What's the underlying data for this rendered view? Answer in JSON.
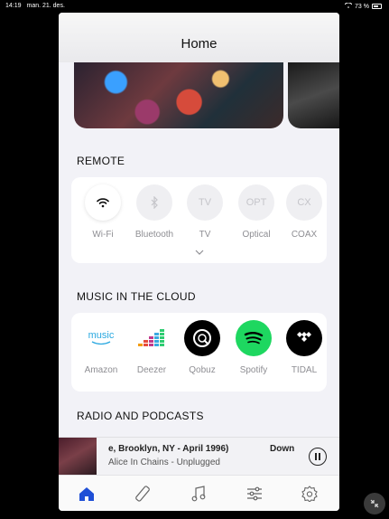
{
  "status_bar": {
    "time": "14:19",
    "date": "man. 21. des.",
    "battery": "73 %"
  },
  "header": {
    "title": "Home"
  },
  "remote": {
    "title": "REMOTE",
    "items": [
      {
        "label": "Wi-Fi",
        "icon": "wifi-icon",
        "glyph": ""
      },
      {
        "label": "Bluetooth",
        "icon": "bluetooth-icon",
        "glyph": ""
      },
      {
        "label": "TV",
        "icon": "tv-icon",
        "glyph": "TV"
      },
      {
        "label": "Optical",
        "icon": "optical-icon",
        "glyph": "OPT"
      },
      {
        "label": "COAX",
        "icon": "coax-icon",
        "glyph": "CX"
      }
    ]
  },
  "cloud": {
    "title": "MUSIC IN THE CLOUD",
    "items": [
      {
        "label": "Amazon",
        "icon": "amazon-music-icon",
        "glyph": "music"
      },
      {
        "label": "Deezer",
        "icon": "deezer-icon"
      },
      {
        "label": "Qobuz",
        "icon": "qobuz-icon"
      },
      {
        "label": "Spotify",
        "icon": "spotify-icon"
      },
      {
        "label": "TIDAL",
        "icon": "tidal-icon"
      }
    ]
  },
  "radio": {
    "title": "RADIO AND PODCASTS"
  },
  "player": {
    "line1": "e, Brooklyn, NY - April 1996)",
    "line2": "Alice In Chains - Unplugged",
    "room": "Down"
  },
  "tabs": [
    {
      "name": "tab-home",
      "icon": "home-icon"
    },
    {
      "name": "tab-products",
      "icon": "remote-icon"
    },
    {
      "name": "tab-music",
      "icon": "music-note-icon"
    },
    {
      "name": "tab-equalizer",
      "icon": "sliders-icon"
    },
    {
      "name": "tab-settings",
      "icon": "gear-icon"
    }
  ],
  "colors": {
    "accent": "#1f4fd6",
    "spotify": "#1ed760",
    "tidal": "#000000",
    "qobuz": "#000000"
  }
}
